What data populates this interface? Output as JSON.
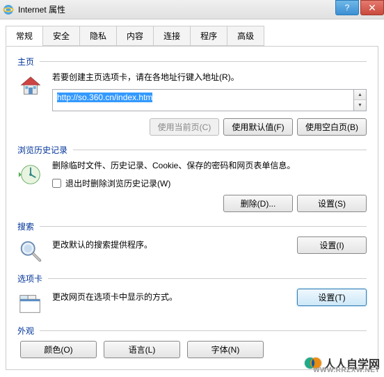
{
  "window": {
    "title": "Internet 属性",
    "help": "?",
    "close": "✕"
  },
  "tabs": [
    "常规",
    "安全",
    "隐私",
    "内容",
    "连接",
    "程序",
    "高级"
  ],
  "homepage": {
    "title": "主页",
    "desc": "若要创建主页选项卡，请在各地址行键入地址(R)。",
    "url": "http://so.360.cn/index.htm",
    "btn_current": "使用当前页(C)",
    "btn_default": "使用默认值(F)",
    "btn_blank": "使用空白页(B)"
  },
  "history": {
    "title": "浏览历史记录",
    "desc": "删除临时文件、历史记录、Cookie、保存的密码和网页表单信息。",
    "exit_delete": "退出时删除浏览历史记录(W)",
    "btn_delete": "删除(D)...",
    "btn_settings": "设置(S)"
  },
  "search": {
    "title": "搜索",
    "desc": "更改默认的搜索提供程序。",
    "btn_settings": "设置(I)"
  },
  "tabs_section": {
    "title": "选项卡",
    "desc": "更改网页在选项卡中显示的方式。",
    "btn_settings": "设置(T)"
  },
  "appearance": {
    "title": "外观",
    "btn_color": "颜色(O)",
    "btn_lang": "语言(L)",
    "btn_font": "字体(N)"
  },
  "watermark": {
    "text": "人人自学网",
    "sub": "WWW.RRZXW.NET"
  }
}
